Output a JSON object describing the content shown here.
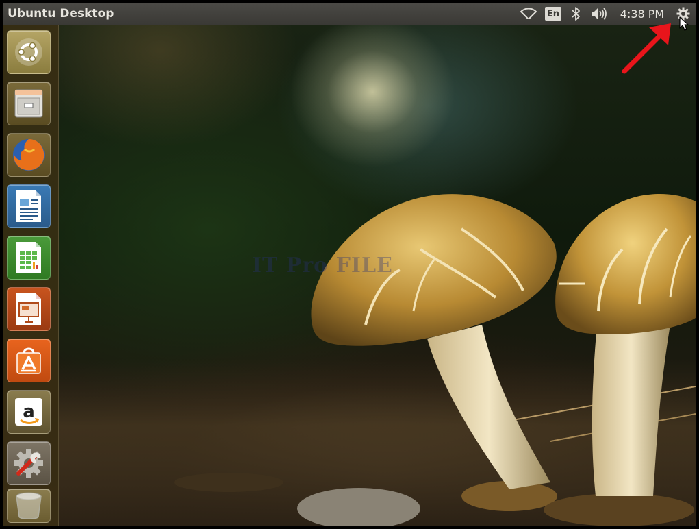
{
  "top_panel": {
    "window_title": "Ubuntu Desktop",
    "keyboard_layout": "En",
    "clock": "4:38 PM",
    "indicators": [
      "wifi-icon",
      "keyboard-layout",
      "bluetooth-icon",
      "volume-icon",
      "clock",
      "system-settings-gear-icon"
    ]
  },
  "launcher": {
    "items": [
      {
        "name": "Dash Home",
        "icon": "ubuntu-logo-icon"
      },
      {
        "name": "Files",
        "icon": "file-cabinet-icon"
      },
      {
        "name": "Firefox Web Browser",
        "icon": "firefox-icon"
      },
      {
        "name": "LibreOffice Writer",
        "icon": "writer-document-icon"
      },
      {
        "name": "LibreOffice Calc",
        "icon": "calc-spreadsheet-icon"
      },
      {
        "name": "LibreOffice Impress",
        "icon": "impress-presentation-icon"
      },
      {
        "name": "Ubuntu Software Center",
        "icon": "software-center-bag-icon"
      },
      {
        "name": "Amazon",
        "icon": "amazon-icon"
      },
      {
        "name": "System Settings",
        "icon": "settings-gear-wrench-icon"
      },
      {
        "name": "Trash",
        "icon": "trash-icon"
      }
    ]
  },
  "desktop": {
    "wallpaper": "mushrooms-wallpaper",
    "watermark": "IT Pro FILE",
    "annotation": "red-arrow-pointing-to-gear"
  },
  "colors": {
    "panel": "#3f3e3a",
    "launcher": "#3c3014",
    "arrow": "#e8151b"
  }
}
